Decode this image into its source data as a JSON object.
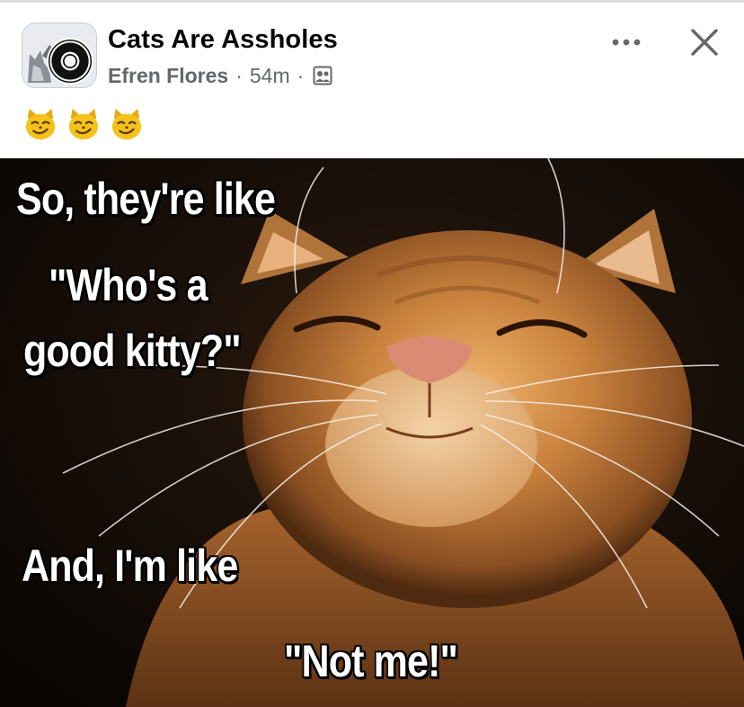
{
  "post": {
    "group_name": "Cats Are Assholes",
    "author": "Efren Flores",
    "separator": "·",
    "time": "54m",
    "privacy_icon": "group-members-icon",
    "caption_emojis": [
      "smirking-cat-icon",
      "smirking-cat-icon",
      "smirking-cat-icon"
    ],
    "actions": {
      "more_icon": "more-dots-icon",
      "close_icon": "close-icon"
    }
  },
  "meme": {
    "lines": [
      "So, they're like",
      "\"Who's a",
      "good kitty?\"",
      "And, I'm like",
      "\"Not me!\""
    ]
  },
  "colors": {
    "primary_text": "#050505",
    "secondary_text": "#65676b",
    "divider": "#d9dadc",
    "emoji_yellow": "#f4c21a"
  }
}
